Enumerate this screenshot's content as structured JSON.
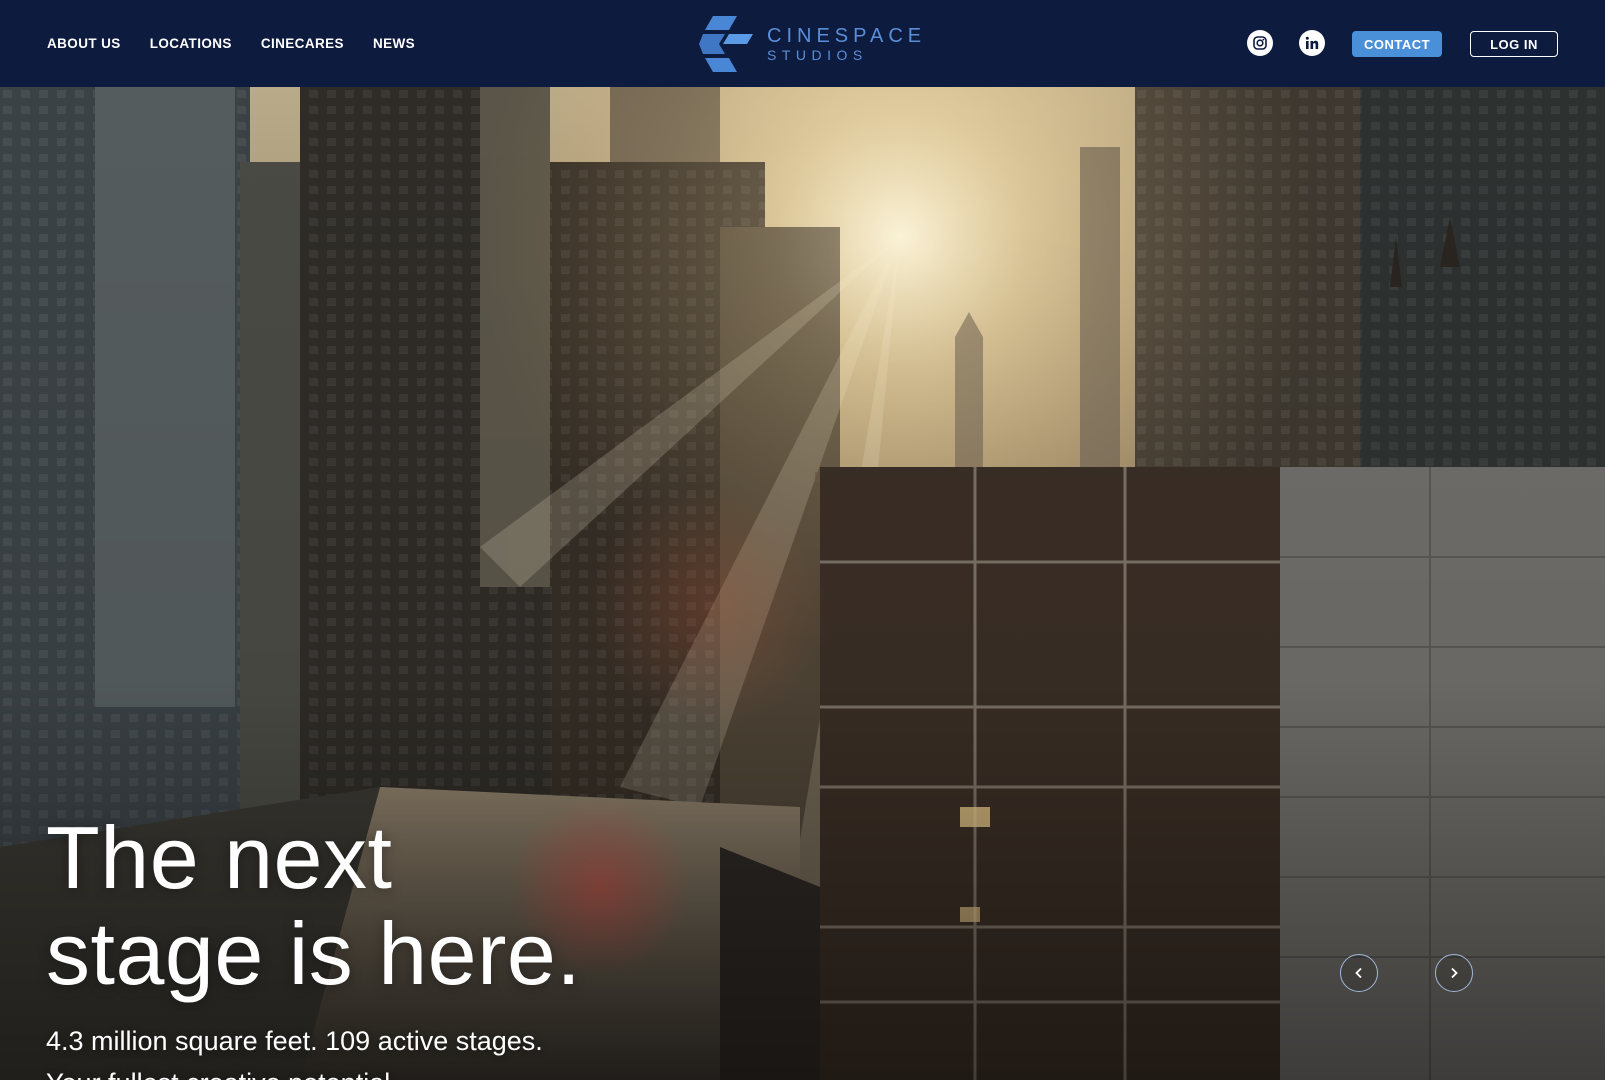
{
  "header": {
    "nav": [
      {
        "label": "ABOUT US"
      },
      {
        "label": "LOCATIONS"
      },
      {
        "label": "CINECARES"
      },
      {
        "label": "NEWS"
      }
    ],
    "logo": {
      "line1": "CINESPACE",
      "line2": "STUDIOS",
      "icon": "cinespace-logo-mark"
    },
    "social": [
      {
        "icon": "instagram-icon"
      },
      {
        "icon": "linkedin-icon"
      }
    ],
    "contact_label": "CONTACT",
    "login_label": "LOG IN"
  },
  "hero": {
    "headline": [
      "The next",
      "stage is here."
    ],
    "subline": [
      "4.3 million square feet. 109 active stages.",
      "Your fullest creative potential."
    ],
    "prev_icon": "chevron-left-icon",
    "next_icon": "chevron-right-icon"
  },
  "colors": {
    "nav_background": "#0d1b3f",
    "accent": "#4a90d9",
    "logo": "#5a8fd8"
  }
}
